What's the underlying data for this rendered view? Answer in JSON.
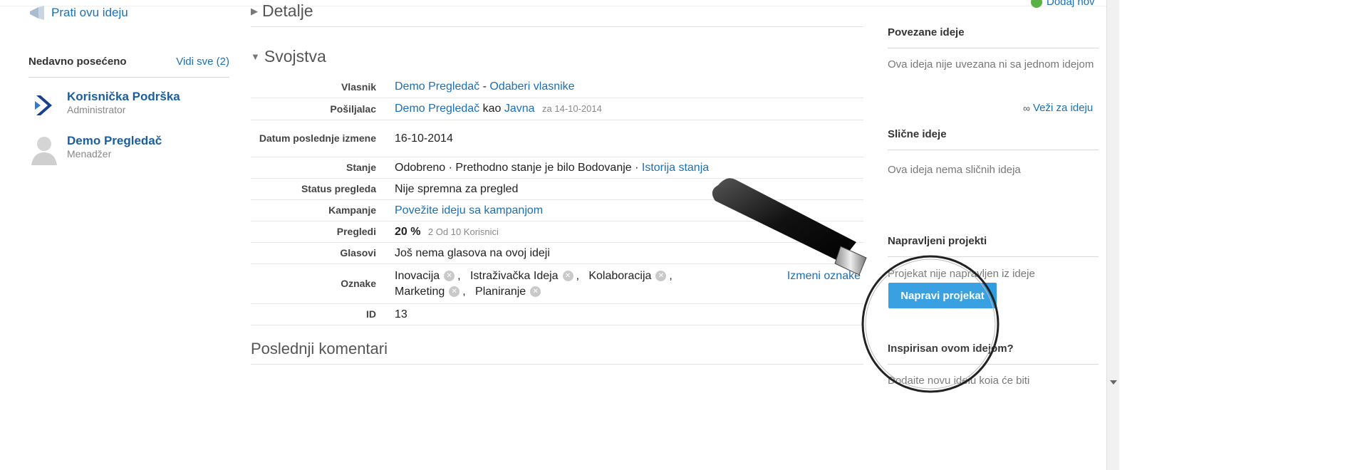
{
  "left": {
    "follow_label": "Prati ovu ideju",
    "recent_title": "Nedavno posećeno",
    "recent_all": "Vidi sve (2)",
    "people": [
      {
        "name": "Korisnička Podrška",
        "role": "Administrator"
      },
      {
        "name": "Demo Pregledač",
        "role": "Menadžer"
      }
    ]
  },
  "middle": {
    "details_title": "Detalje",
    "props_title": "Svojstva",
    "comments_title": "Poslednji komentari",
    "rows": {
      "owner": {
        "label": "Vlasnik",
        "user": "Demo Pregledač",
        "sep": " - ",
        "action": "Odaberi vlasnike"
      },
      "sender": {
        "label": "Pošiljalac",
        "user": "Demo Pregledač",
        "as": " kao ",
        "visibility": "Javna",
        "date": "za 14-10-2014"
      },
      "modified": {
        "label": "Datum poslednje izmene",
        "value": "16-10-2014"
      },
      "state": {
        "label": "Stanje",
        "value": "Odobreno · Prethodno stanje je bilo Bodovanje · ",
        "history": "Istorija stanja"
      },
      "review_status": {
        "label": "Status pregleda",
        "value": "Nije spremna za pregled"
      },
      "campaigns": {
        "label": "Kampanje",
        "value": "Povežite ideju sa kampanjom"
      },
      "views": {
        "label": "Pregledi",
        "percent": "20 %",
        "detail": "2 Od 10 Korisnici"
      },
      "votes": {
        "label": "Glasovi",
        "value": "Još nema glasova na ovoj ideji"
      },
      "tags": {
        "label": "Oznake",
        "items": [
          "Inovacija",
          "Istraživačka Ideja",
          "Kolaboracija",
          "Marketing",
          "Planiranje"
        ],
        "edit": "Izmeni oznake"
      },
      "id": {
        "label": "ID",
        "value": "13"
      }
    }
  },
  "right": {
    "add_new": "Dodaj nov",
    "related_title": "Povezane ideje",
    "related_text": "Ova ideja nije uvezana ni sa jednom idejom",
    "link_label": "Veži za ideju",
    "similar_title": "Slične ideje",
    "similar_text": "Ova ideja nema sličnih ideja",
    "projects_title": "Napravljeni projekti",
    "projects_text": "Projekat nije napravljen iz ideje",
    "projects_button": "Napravi projekat",
    "inspired_title": "Inspirisan ovom idejom?",
    "inspired_text": "Dodaite novu ideiu koia će biti"
  },
  "colors": {
    "link": "#1b6fb5",
    "button": "#2f9be0",
    "add_icon": "#5ab244"
  }
}
